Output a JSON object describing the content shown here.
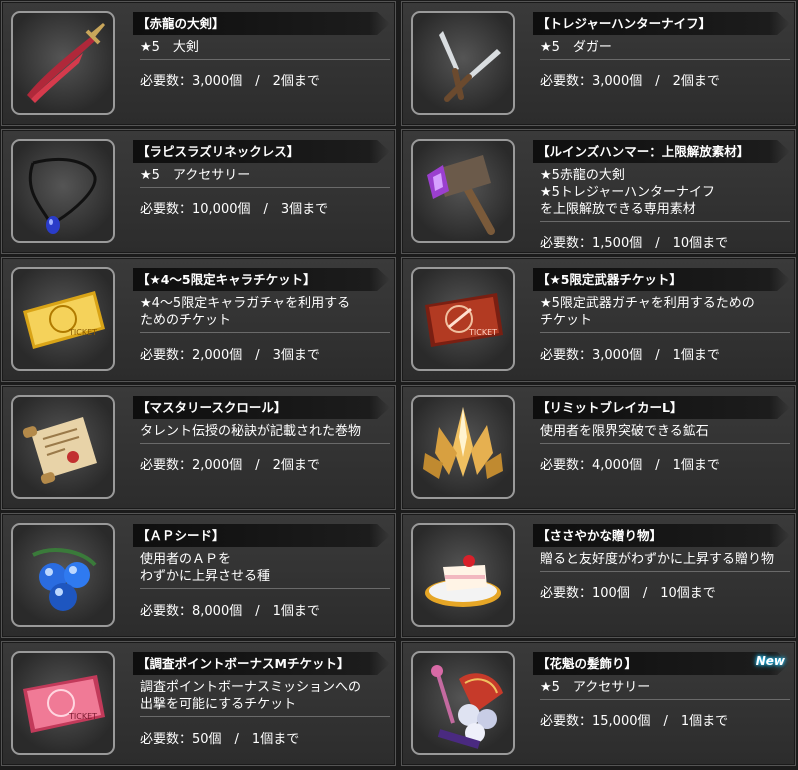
{
  "items": [
    {
      "name": "【赤龍の大剣】",
      "desc": [
        "★5　大剣"
      ],
      "req": "必要数：3,000個　/　2個まで",
      "icon": "sword-icon"
    },
    {
      "name": "【トレジャーハンターナイフ】",
      "desc": [
        "★5　ダガー"
      ],
      "req": "必要数：3,000個　/　2個まで",
      "icon": "dagger-icon"
    },
    {
      "name": "【ラピスラズリネックレス】",
      "desc": [
        "★5　アクセサリー"
      ],
      "req": "必要数：10,000個　/　3個まで",
      "icon": "necklace-icon"
    },
    {
      "name": "【ルインズハンマー：上限解放素材】",
      "desc": [
        "★5赤龍の大剣",
        "★5トレジャーハンターナイフ",
        "を上限解放できる専用素材"
      ],
      "req": "必要数：1,500個　/　10個まで",
      "icon": "hammer-icon"
    },
    {
      "name": "【★4～5限定キャラチケット】",
      "desc": [
        "★4～5限定キャラガチャを利用する",
        "ためのチケット"
      ],
      "req": "必要数：2,000個　/　3個まで",
      "icon": "gold-ticket-icon"
    },
    {
      "name": "【★5限定武器チケット】",
      "desc": [
        "★5限定武器ガチャを利用するための",
        "チケット"
      ],
      "req": "必要数：3,000個　/　1個まで",
      "icon": "red-ticket-icon"
    },
    {
      "name": "【マスタリースクロール】",
      "desc": [
        "タレント伝授の秘訣が記載された巻物"
      ],
      "req": "必要数：2,000個　/　2個まで",
      "icon": "scroll-icon"
    },
    {
      "name": "【リミットブレイカーL】",
      "desc": [
        "使用者を限界突破できる鉱石"
      ],
      "req": "必要数：4,000個　/　1個まで",
      "icon": "crystal-icon"
    },
    {
      "name": "【ＡＰシード】",
      "desc": [
        "使用者のＡＰを",
        "わずかに上昇させる種"
      ],
      "req": "必要数：8,000個　/　1個まで",
      "icon": "seed-icon"
    },
    {
      "name": "【ささやかな贈り物】",
      "desc": [
        "贈ると友好度がわずかに上昇する贈り物"
      ],
      "req": "必要数：100個　/　10個まで",
      "icon": "cake-icon"
    },
    {
      "name": "【調査ポイントボーナスMチケット】",
      "desc": [
        "調査ポイントボーナスミッションへの",
        "出撃を可能にするチケット"
      ],
      "req": "必要数：50個　/　1個まで",
      "icon": "pink-ticket-icon"
    },
    {
      "name": "【花魁の髪飾り】",
      "desc": [
        "★5　アクセサリー"
      ],
      "req": "必要数：15,000個　/　1個まで",
      "icon": "hair-ornament-icon",
      "badge": "New"
    }
  ]
}
